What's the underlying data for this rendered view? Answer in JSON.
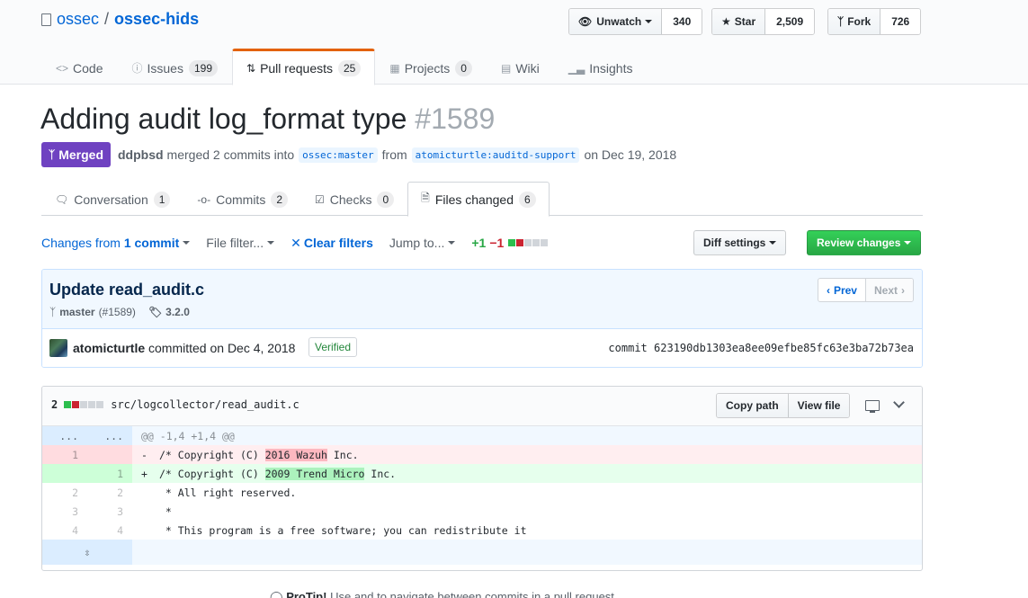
{
  "repo": {
    "owner": "ossec",
    "separator": "/",
    "name": "ossec-hids",
    "unwatch_label": "Unwatch",
    "watch_count": "340",
    "star_label": "Star",
    "star_count": "2,509",
    "fork_label": "Fork",
    "fork_count": "726"
  },
  "reponav": {
    "code": "Code",
    "issues": "Issues",
    "issues_count": "199",
    "pulls": "Pull requests",
    "pulls_count": "25",
    "projects": "Projects",
    "projects_count": "0",
    "wiki": "Wiki",
    "insights": "Insights"
  },
  "pr": {
    "title": "Adding audit log_format type",
    "number": "#1589",
    "state": "Merged",
    "author": "ddpbsd",
    "merged_text": "merged 2 commits into",
    "base_branch": "ossec:master",
    "from_text": "from",
    "head_branch": "atomicturtle:auditd-support",
    "date_text": "on Dec 19, 2018"
  },
  "tabs": {
    "conversation": "Conversation",
    "conversation_count": "1",
    "commits": "Commits",
    "commits_count": "2",
    "checks": "Checks",
    "checks_count": "0",
    "files": "Files changed",
    "files_count": "6"
  },
  "toolbar": {
    "changes_from": "Changes from",
    "one_commit": "1 commit",
    "file_filter": "File filter...",
    "clear_filters": "Clear filters",
    "jump_to": "Jump to...",
    "additions": "+1",
    "deletions": "−1",
    "diff_settings": "Diff settings",
    "review_changes": "Review changes"
  },
  "commit": {
    "title": "Update read_audit.c",
    "branch": "master",
    "pr_ref": "(#1589)",
    "tag": "3.2.0",
    "prev": "Prev",
    "next": "Next",
    "author": "atomicturtle",
    "committed_text": "committed on Dec 4, 2018",
    "verified": "Verified",
    "sha_label": "commit",
    "sha": "623190db1303ea8ee09efbe85fc63e3ba72b73ea"
  },
  "file": {
    "change_count": "2",
    "path": "src/logcollector/read_audit.c",
    "copy_path": "Copy path",
    "view_file": "View file",
    "hunk_header": "@@ -1,4 +1,4 @@",
    "hunk_dots": "...",
    "lines": {
      "del": {
        "old": "1",
        "sign": "-",
        "pre": "/* Copyright (C) ",
        "hl": "2016 Wazuh",
        "post": " Inc."
      },
      "add": {
        "new": "1",
        "sign": "+",
        "pre": "/* Copyright (C) ",
        "hl": "2009 Trend Micro",
        "post": " Inc."
      },
      "ctx1": {
        "old": "2",
        "new": "2",
        "text": " * All right reserved."
      },
      "ctx2": {
        "old": "3",
        "new": "3",
        "text": " *"
      },
      "ctx3": {
        "old": "4",
        "new": "4",
        "text": " * This program is a free software; you can redistribute it"
      }
    },
    "expand_glyph": "⇳"
  },
  "protip": {
    "label": "ProTip!",
    "text": "Use",
    "and": "and",
    "rest": "to navigate between commits in a pull request."
  },
  "colors": {
    "merged": "#6f42c1",
    "accent": "#0366d6",
    "add": "#28a745",
    "del": "#cb2431"
  }
}
